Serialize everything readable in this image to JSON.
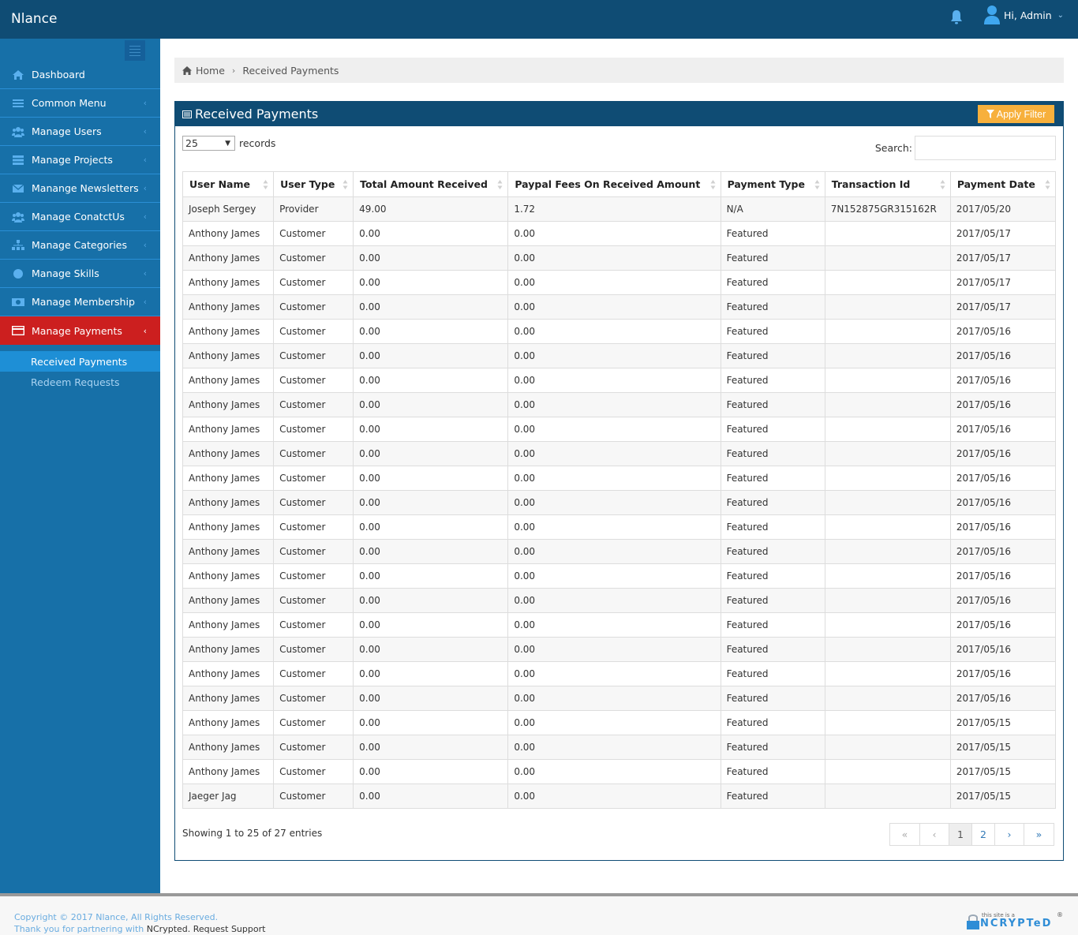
{
  "header": {
    "brand": "Nlance",
    "user_greeting": "Hi, Admin"
  },
  "sidebar": {
    "items": [
      {
        "label": "Dashboard",
        "icon": "home-icon",
        "has_caret": false
      },
      {
        "label": "Common Menu",
        "icon": "list-icon",
        "has_caret": true
      },
      {
        "label": "Manage Users",
        "icon": "users-icon",
        "has_caret": true
      },
      {
        "label": "Manage Projects",
        "icon": "projects-icon",
        "has_caret": true
      },
      {
        "label": "Manange Newsletters",
        "icon": "envelope-icon",
        "has_caret": true
      },
      {
        "label": "Manage ConatctUs",
        "icon": "users-icon",
        "has_caret": true
      },
      {
        "label": "Manage Categories",
        "icon": "sitemap-icon",
        "has_caret": true
      },
      {
        "label": "Manage Skills",
        "icon": "gear-icon",
        "has_caret": true
      },
      {
        "label": "Manage Membership",
        "icon": "money-icon",
        "has_caret": true
      },
      {
        "label": "Manage Payments",
        "icon": "credit-card-icon",
        "has_caret": true,
        "active": true
      }
    ],
    "sub_items": [
      {
        "label": "Received Payments",
        "active": true
      },
      {
        "label": "Redeem Requests",
        "active": false
      }
    ],
    "caret_glyph": "‹"
  },
  "breadcrumb": {
    "home": "Home",
    "separator": "›",
    "current": "Received Payments"
  },
  "panel": {
    "title": "Received Payments",
    "apply_filter_label": "Apply Filter",
    "length_value": "25",
    "length_suffix": "records",
    "search_label": "Search:",
    "search_value": "",
    "columns": [
      "User Name",
      "User Type",
      "Total Amount Received",
      "Paypal Fees On Received Amount",
      "Payment Type",
      "Transaction Id",
      "Payment Date"
    ],
    "rows": [
      [
        "Joseph Sergey",
        "Provider",
        "49.00",
        "1.72",
        "N/A",
        "7N152875GR315162R",
        "2017/05/20"
      ],
      [
        "Anthony James",
        "Customer",
        "0.00",
        "0.00",
        "Featured",
        "",
        "2017/05/17"
      ],
      [
        "Anthony James",
        "Customer",
        "0.00",
        "0.00",
        "Featured",
        "",
        "2017/05/17"
      ],
      [
        "Anthony James",
        "Customer",
        "0.00",
        "0.00",
        "Featured",
        "",
        "2017/05/17"
      ],
      [
        "Anthony James",
        "Customer",
        "0.00",
        "0.00",
        "Featured",
        "",
        "2017/05/17"
      ],
      [
        "Anthony James",
        "Customer",
        "0.00",
        "0.00",
        "Featured",
        "",
        "2017/05/16"
      ],
      [
        "Anthony James",
        "Customer",
        "0.00",
        "0.00",
        "Featured",
        "",
        "2017/05/16"
      ],
      [
        "Anthony James",
        "Customer",
        "0.00",
        "0.00",
        "Featured",
        "",
        "2017/05/16"
      ],
      [
        "Anthony James",
        "Customer",
        "0.00",
        "0.00",
        "Featured",
        "",
        "2017/05/16"
      ],
      [
        "Anthony James",
        "Customer",
        "0.00",
        "0.00",
        "Featured",
        "",
        "2017/05/16"
      ],
      [
        "Anthony James",
        "Customer",
        "0.00",
        "0.00",
        "Featured",
        "",
        "2017/05/16"
      ],
      [
        "Anthony James",
        "Customer",
        "0.00",
        "0.00",
        "Featured",
        "",
        "2017/05/16"
      ],
      [
        "Anthony James",
        "Customer",
        "0.00",
        "0.00",
        "Featured",
        "",
        "2017/05/16"
      ],
      [
        "Anthony James",
        "Customer",
        "0.00",
        "0.00",
        "Featured",
        "",
        "2017/05/16"
      ],
      [
        "Anthony James",
        "Customer",
        "0.00",
        "0.00",
        "Featured",
        "",
        "2017/05/16"
      ],
      [
        "Anthony James",
        "Customer",
        "0.00",
        "0.00",
        "Featured",
        "",
        "2017/05/16"
      ],
      [
        "Anthony James",
        "Customer",
        "0.00",
        "0.00",
        "Featured",
        "",
        "2017/05/16"
      ],
      [
        "Anthony James",
        "Customer",
        "0.00",
        "0.00",
        "Featured",
        "",
        "2017/05/16"
      ],
      [
        "Anthony James",
        "Customer",
        "0.00",
        "0.00",
        "Featured",
        "",
        "2017/05/16"
      ],
      [
        "Anthony James",
        "Customer",
        "0.00",
        "0.00",
        "Featured",
        "",
        "2017/05/16"
      ],
      [
        "Anthony James",
        "Customer",
        "0.00",
        "0.00",
        "Featured",
        "",
        "2017/05/16"
      ],
      [
        "Anthony James",
        "Customer",
        "0.00",
        "0.00",
        "Featured",
        "",
        "2017/05/15"
      ],
      [
        "Anthony James",
        "Customer",
        "0.00",
        "0.00",
        "Featured",
        "",
        "2017/05/15"
      ],
      [
        "Anthony James",
        "Customer",
        "0.00",
        "0.00",
        "Featured",
        "",
        "2017/05/15"
      ],
      [
        "Jaeger Jag",
        "Customer",
        "0.00",
        "0.00",
        "Featured",
        "",
        "2017/05/15"
      ]
    ],
    "info": "Showing 1 to 25 of 27 entries",
    "pagination": [
      {
        "label": "«",
        "state": "disabled",
        "name": "first"
      },
      {
        "label": "‹",
        "state": "disabled",
        "name": "previous"
      },
      {
        "label": "1",
        "state": "current",
        "name": "page-1"
      },
      {
        "label": "2",
        "state": "normal",
        "name": "page-2"
      },
      {
        "label": "›",
        "state": "normal",
        "name": "next"
      },
      {
        "label": "»",
        "state": "normal",
        "name": "last"
      }
    ]
  },
  "footer": {
    "copyright": "Copyright © 2017 Nlance, All Rights Reserved.",
    "partner_prefix": "Thank you for partnering with ",
    "partner_name": "NCrypted",
    "partner_dot": ". ",
    "support_link": "Request Support",
    "badge_small": "this site is a",
    "badge_big": "NCRYPTeD",
    "badge_reg": "®"
  },
  "colors": {
    "topbar": "#0f4c74",
    "sidebar": "#1770a8",
    "active_nav": "#cc1f1f",
    "active_sub": "#1e8fd6",
    "filter_button": "#f7b03c",
    "link": "#337ab7"
  }
}
